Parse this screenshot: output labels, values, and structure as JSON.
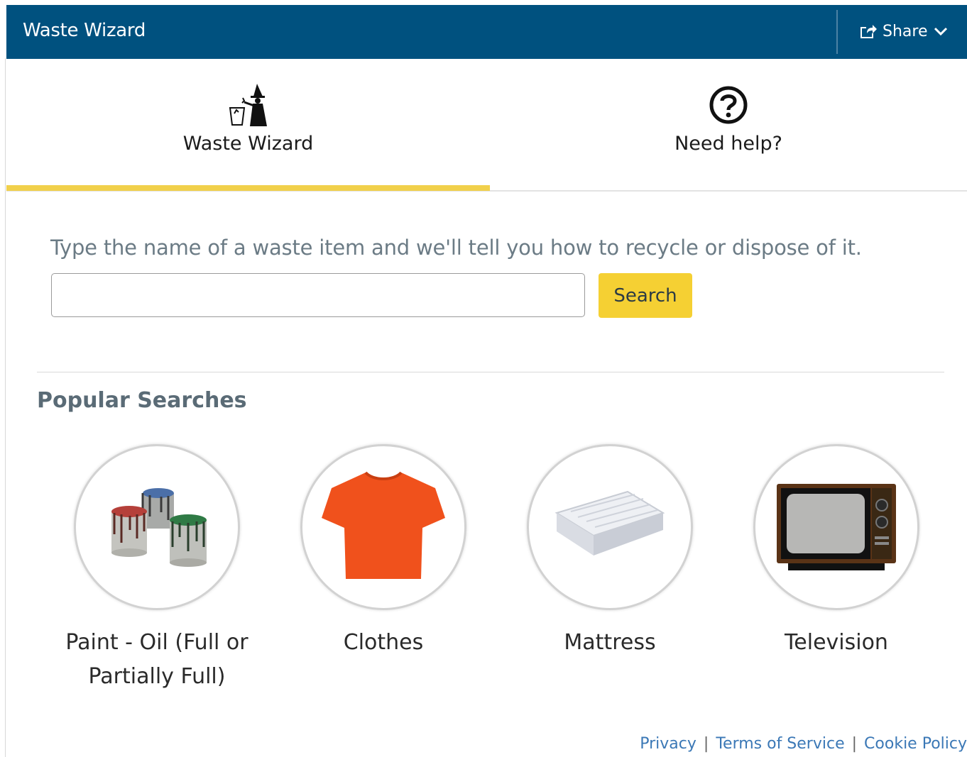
{
  "header": {
    "title": "Waste Wizard",
    "share_label": "Share",
    "background": "#00517f"
  },
  "tabs": [
    {
      "label": "Waste Wizard",
      "icon": "wizard-icon",
      "active": true
    },
    {
      "label": "Need help?",
      "icon": "question-circle-icon",
      "active": false
    }
  ],
  "search": {
    "intro": "Type the name of a waste item and we'll tell you how to recycle or dispose of it.",
    "value": "",
    "placeholder": "",
    "button_label": "Search",
    "button_color": "#f5d033"
  },
  "popular": {
    "title": "Popular Searches",
    "items": [
      {
        "label": "Paint - Oil (Full or Partially Full)",
        "icon": "paint-cans-icon"
      },
      {
        "label": "Clothes",
        "icon": "tshirt-icon"
      },
      {
        "label": "Mattress",
        "icon": "mattress-icon"
      },
      {
        "label": "Television",
        "icon": "television-icon"
      }
    ]
  },
  "footer": {
    "links": [
      "Privacy",
      "Terms of Service",
      "Cookie Policy"
    ],
    "separator": "|"
  },
  "colors": {
    "accent_yellow": "#f1d04b",
    "link_blue": "#3b78b6"
  }
}
